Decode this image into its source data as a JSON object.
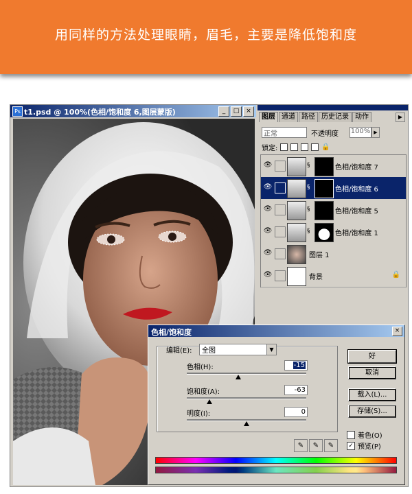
{
  "banner": {
    "text": "用同样的方法处理眼睛，眉毛，主要是降低饱和度"
  },
  "document": {
    "title": "t1.psd @ 100%(色相/饱和度 6,图层蒙版)",
    "buttons": [
      "_",
      "□",
      "×"
    ]
  },
  "layers_panel": {
    "tabs": [
      "图层",
      "通道",
      "路径",
      "历史记录",
      "动作"
    ],
    "blend_mode": "正常",
    "opacity_label": "不透明度",
    "opacity_value": "100%",
    "lock_label": "锁定:",
    "layers": [
      {
        "name": "色相/饱和度 7",
        "selected": false,
        "mask": "dark"
      },
      {
        "name": "色相/饱和度 6",
        "selected": true,
        "mask": "dark"
      },
      {
        "name": "色相/饱和度 5",
        "selected": false,
        "mask": "dark"
      },
      {
        "name": "色相/饱和度 1",
        "selected": false,
        "mask": "light"
      },
      {
        "name": "图层 1",
        "selected": false,
        "mask": "none"
      },
      {
        "name": "背景",
        "selected": false,
        "mask": "none"
      }
    ]
  },
  "dialog": {
    "title": "色相/饱和度",
    "edit_label": "编辑(E):",
    "edit_value": "全图",
    "hue_label": "色相(H):",
    "hue_value": "-15",
    "saturation_label": "饱和度(A):",
    "saturation_value": "-63",
    "lightness_label": "明度(I):",
    "lightness_value": "0",
    "ok_label": "好",
    "cancel_label": "取消",
    "load_label": "载入(L)...",
    "save_label": "存储(S)...",
    "colorize_label": "着色(O)",
    "preview_label": "预览(P)",
    "preview_checked": true,
    "colorize_checked": false
  }
}
